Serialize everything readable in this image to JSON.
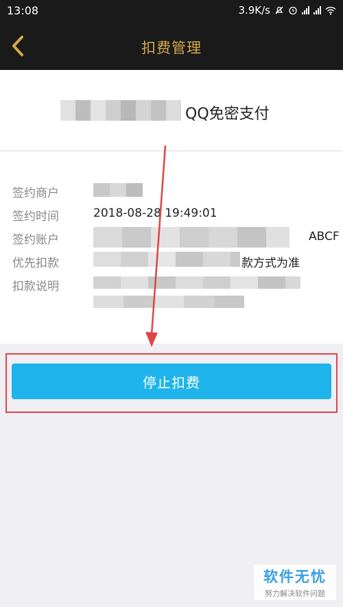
{
  "status_bar": {
    "time": "13:08",
    "speed": "3.9K/s"
  },
  "nav": {
    "title": "扣费管理"
  },
  "product": {
    "name_suffix": "QQ免密支付"
  },
  "info": {
    "merchant_label": "签约商户",
    "time_label": "签约时间",
    "time_value": "2018-08-28 19:49:01",
    "account_label": "签约账户",
    "account_suffix": "ABCF",
    "priority_label": "优先扣款",
    "priority_suffix": "款方式为准",
    "desc_label": "扣款说明"
  },
  "actions": {
    "stop_label": "停止扣费"
  },
  "watermark": {
    "title": "软件无忧",
    "subtitle": "努力解决软件问题"
  },
  "colors": {
    "nav_bg": "#1a1a1a",
    "accent_gold": "#d6a84c",
    "button_blue": "#1fb4ec",
    "annotation_red": "#e04545"
  }
}
